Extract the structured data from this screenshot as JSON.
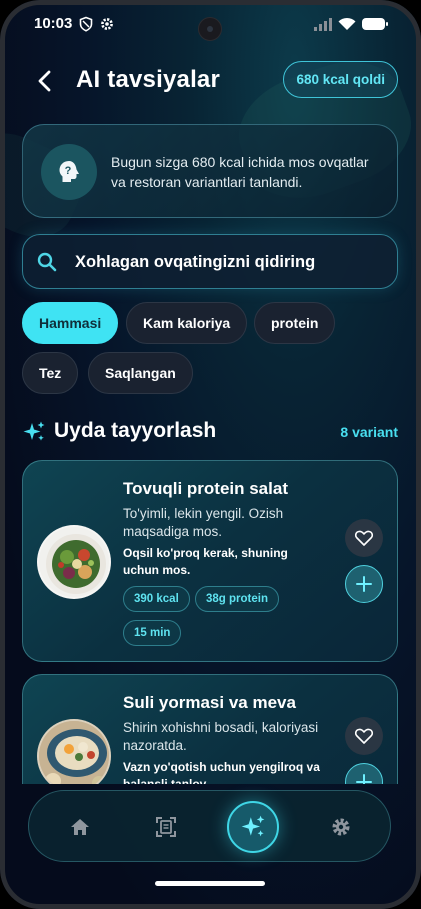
{
  "status_bar": {
    "time": "10:03"
  },
  "header": {
    "title": "AI tavsiyalar",
    "calorie_badge": "680 kcal qoldi"
  },
  "info_card": {
    "text": "Bugun sizga 680 kcal ichida mos ovqatlar va restoran variantlari tanlandi."
  },
  "search": {
    "placeholder": "Xohlagan ovqatingizni qidiring",
    "value": ""
  },
  "filters": [
    {
      "label": "Hammasi",
      "active": true
    },
    {
      "label": "Kam kaloriya",
      "active": false
    },
    {
      "label": "protein",
      "active": false
    },
    {
      "label": "Tez",
      "active": false
    },
    {
      "label": "Saqlangan",
      "active": false
    }
  ],
  "section": {
    "title": "Uyda tayyorlash",
    "count": "8 variant"
  },
  "meals": [
    {
      "title": "Tovuqli protein salat",
      "description": "To'yimli, lekin yengil. Ozish maqsadiga mos.",
      "note": "Oqsil ko'proq kerak, shuning uchun mos.",
      "tags": [
        "390 kcal",
        "38g protein",
        "15 min"
      ]
    },
    {
      "title": "Suli yormasi va meva",
      "description": "Shirin xohishni bosadi, kaloriyasi nazoratda.",
      "note": "Vazn yo'qotish uchun yengilroq va balansli tanlov."
    }
  ],
  "nav": {
    "items": [
      "home-icon",
      "scan-icon",
      "ai-sparkle-icon",
      "settings-icon"
    ],
    "active": "ai-sparkle-icon"
  },
  "colors": {
    "accent": "#3fe3f3",
    "background": "#050b1c",
    "card": "#0f4452"
  }
}
